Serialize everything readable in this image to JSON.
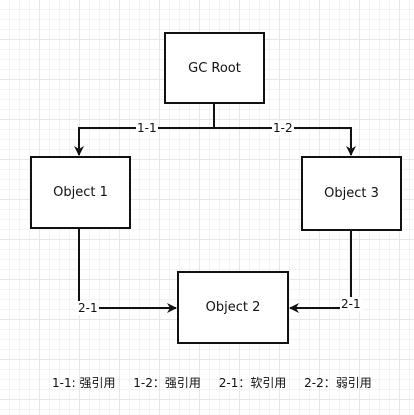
{
  "diagram": {
    "nodes": {
      "gc_root": "GC Root",
      "object_1": "Object 1",
      "object_3": "Object 3",
      "object_2": "Object 2"
    },
    "edges": {
      "root_to_obj1": "1-1",
      "root_to_obj3": "1-2",
      "obj1_to_obj2": "2-1",
      "obj3_to_obj2": "2-1"
    },
    "legend": [
      "1-1: 强引用",
      "1-2：强引用",
      "2-1：软引用",
      "2-2：弱引用"
    ],
    "colors": {
      "stroke": "#111111",
      "grid": "#e7e7e7",
      "background": "#ffffff"
    }
  }
}
